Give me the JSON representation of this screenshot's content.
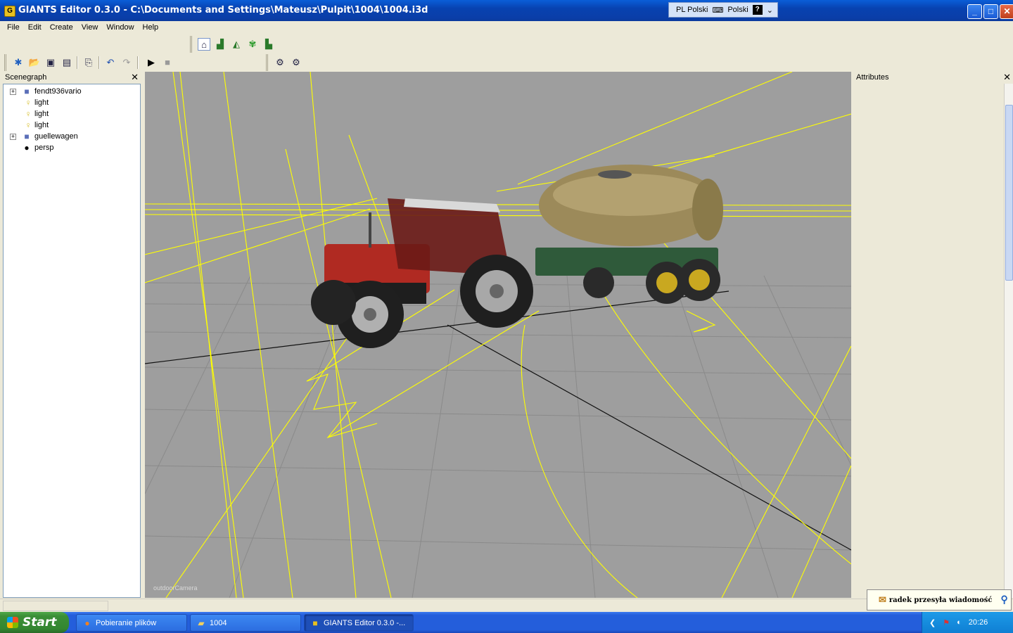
{
  "window": {
    "title": "GIANTS Editor 0.3.0 - C:\\Documents and Settings\\Mateusz\\Pulpit\\1004\\1004.i3d",
    "icon": "app-icon",
    "controls": {
      "minimize": "_",
      "maximize": "□",
      "close": "✕"
    }
  },
  "language_bar": {
    "code": "PL Polski",
    "keyboard": "Polski",
    "help": "?"
  },
  "menu": [
    "File",
    "Edit",
    "Create",
    "View",
    "Window",
    "Help"
  ],
  "toolbar_top": [
    "home-icon",
    "terrain-paint-icon",
    "terrain-sculpt-icon",
    "foliage-paint-icon",
    "texture-paint-icon"
  ],
  "toolbar_main": [
    "new-icon",
    "open-icon",
    "save-icon",
    "save-all-icon",
    "import-icon",
    "undo-icon",
    "redo-icon",
    "play-icon",
    "stop-icon"
  ],
  "toolbar_extra": [
    "settings-icon",
    "settings-alt-icon"
  ],
  "scenegraph": {
    "title": "Scenegraph",
    "nodes": [
      {
        "label": "fendt936vario",
        "type": "transform",
        "expandable": true
      },
      {
        "label": "light",
        "type": "light",
        "expandable": false
      },
      {
        "label": "light",
        "type": "light",
        "expandable": false
      },
      {
        "label": "light",
        "type": "light",
        "expandable": false
      },
      {
        "label": "guellewagen",
        "type": "transform",
        "expandable": true
      },
      {
        "label": "persp",
        "type": "camera",
        "expandable": false
      }
    ]
  },
  "viewport": {
    "camera_label": "outdoorCamera",
    "background": "#9e9e9e",
    "grid_color": "#8a8a8a",
    "gizmo_color": "#ffff00"
  },
  "attributes": {
    "title": "Attributes"
  },
  "notification": {
    "text": "radek przesyła wiadomość"
  },
  "taskbar": {
    "start": "Start",
    "tasks": [
      {
        "label": "Pobieranie plików",
        "icon": "firefox-icon"
      },
      {
        "label": "1004",
        "icon": "folder-icon"
      },
      {
        "label": "GIANTS Editor 0.3.0 -...",
        "icon": "giants-icon",
        "active": true
      }
    ],
    "clock": "20:26"
  }
}
